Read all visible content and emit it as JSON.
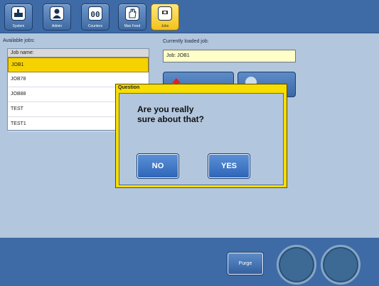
{
  "nav": {
    "items": [
      {
        "label": "System",
        "icon": "system-icon"
      },
      {
        "label": "Admin",
        "icon": "user-icon"
      },
      {
        "label": "Counters",
        "icon": "counter-icon"
      },
      {
        "label": "Man Feed",
        "icon": "hand-icon"
      },
      {
        "label": "Jobs",
        "icon": "jobs-icon",
        "active": true
      }
    ]
  },
  "jobs": {
    "available_label": "Available jobs:",
    "column_header": "Job name:",
    "rows": [
      "JOB1",
      "JOB78",
      "JOB88",
      "TEST",
      "TEST1"
    ],
    "selected": "JOB1"
  },
  "loaded": {
    "label": "Currently loaded job:",
    "value": "Job: JOB1"
  },
  "dialog": {
    "title": "Question",
    "message": "Are you really\nsure about that?",
    "no_label": "NO",
    "yes_label": "YES"
  },
  "bottom": {
    "purge_label": "Purge"
  },
  "colors": {
    "accent": "#3e6ba6",
    "selected": "#f6d300",
    "background": "#b2c6dd"
  }
}
